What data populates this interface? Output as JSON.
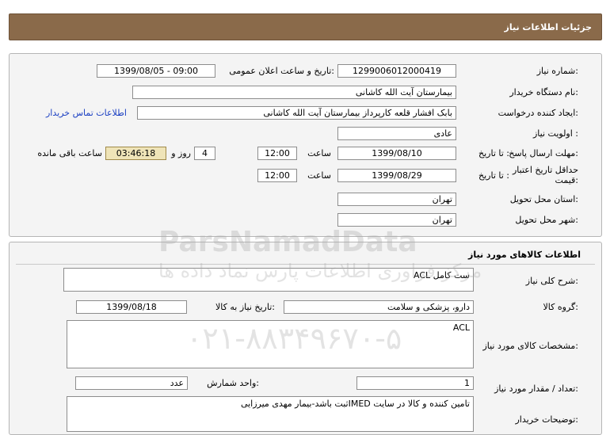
{
  "header": {
    "title": "جزئیات اطلاعات نیاز"
  },
  "info": {
    "need_number_label": "شماره نیاز:",
    "need_number": "1299006012000419",
    "announce_label": "تاریخ و ساعت اعلان عمومی:",
    "announce_value": "1399/08/05 - 09:00",
    "buyer_org_label": "نام دستگاه خریدار:",
    "buyer_org": "بیمارستان آیت الله کاشانی",
    "creator_label": "ایجاد کننده درخواست:",
    "creator": "بابک افشار قلعه کارپرداز بیمارستان آیت الله کاشانی",
    "contact_link": "اطلاعات تماس خریدار",
    "priority_label": "اولویت نیاز :",
    "priority": "عادی",
    "deadline_label": "مهلت ارسال پاسخ:",
    "until_date_label": "تا تاریخ :",
    "deadline_date": "1399/08/10",
    "time_label": "ساعت",
    "deadline_time": "12:00",
    "days_value": "4",
    "days_label": "روز و",
    "remaining_time": "03:46:18",
    "remaining_label": "ساعت باقی مانده",
    "validity_label": "حداقل تاریخ اعتبار قیمت:",
    "validity_date": "1399/08/29",
    "validity_time": "12:00",
    "province_label": "استان محل تحویل:",
    "province": "تهران",
    "city_label": "شهر محل تحویل:",
    "city": "تهران"
  },
  "goods": {
    "section_title": "اطلاعات کالاهای مورد نیاز",
    "summary_label": "شرح کلی نیاز:",
    "summary": "ست کامل ACL",
    "group_label": "گروه کالا:",
    "group": "دارو، پزشکی و سلامت",
    "need_date_label": "تاریخ نیاز به کالا:",
    "need_date": "1399/08/18",
    "spec_label": "مشخصات کالای مورد نیاز:",
    "spec": "ACL",
    "qty_label": "تعداد / مقدار مورد نیاز:",
    "qty": "1",
    "unit_label": "واحد شمارش:",
    "unit": "عدد",
    "buyer_notes_label": "توضیحات خریدار:",
    "buyer_notes": "تامین کننده و کالا در سایت IMEDثبت باشد-بیمار مهدی میرزایی"
  },
  "watermark": {
    "brand": "ParsNamadData",
    "tagline": "مرکز فراوری اطلاعات پارس نماد داده ها",
    "phone": "۰۲۱-۸۸۳۴۹۶۷۰-۵"
  }
}
